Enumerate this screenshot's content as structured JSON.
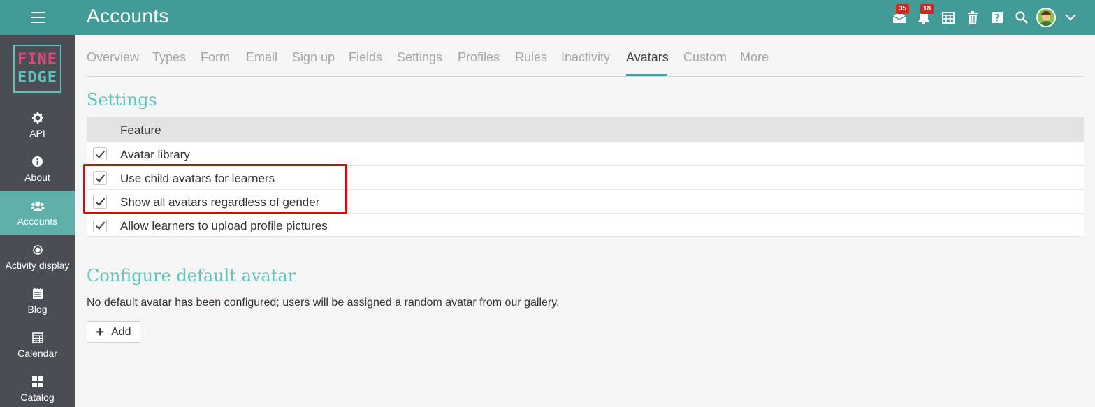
{
  "header": {
    "title": "Accounts",
    "menu_icon": "hamburger-icon",
    "icons": [
      {
        "name": "messages-icon",
        "badge": "35"
      },
      {
        "name": "notifications-icon",
        "badge": "18"
      },
      {
        "name": "calendar-icon"
      },
      {
        "name": "trash-icon"
      },
      {
        "name": "help-icon"
      },
      {
        "name": "search-icon"
      },
      {
        "name": "user-avatar"
      },
      {
        "name": "chevron-down-icon"
      }
    ]
  },
  "logo": {
    "line1": "FINE",
    "line2": "EDGE"
  },
  "sidebar": {
    "items": [
      {
        "label": "API",
        "icon": "gear-icon"
      },
      {
        "label": "About",
        "icon": "info-icon"
      },
      {
        "label": "Accounts",
        "icon": "users-icon",
        "active": true
      },
      {
        "label": "Activity display",
        "icon": "dot-icon"
      },
      {
        "label": "Blog",
        "icon": "blog-icon"
      },
      {
        "label": "Calendar",
        "icon": "calendar-icon"
      },
      {
        "label": "Catalog",
        "icon": "grid-icon"
      }
    ]
  },
  "tabs": [
    {
      "label": "Overview"
    },
    {
      "label": "Types"
    },
    {
      "label": "Form"
    },
    {
      "label": "Email"
    },
    {
      "label": "Sign up"
    },
    {
      "label": "Fields"
    },
    {
      "label": "Settings"
    },
    {
      "label": "Profiles"
    },
    {
      "label": "Rules"
    },
    {
      "label": "Inactivity"
    },
    {
      "label": "Avatars",
      "active": true
    },
    {
      "label": "Custom"
    },
    {
      "label": "More"
    }
  ],
  "settings": {
    "title": "Settings",
    "column_header": "Feature",
    "features": [
      {
        "label": "Avatar library",
        "checked": true
      },
      {
        "label": "Use child avatars for learners",
        "checked": true
      },
      {
        "label": "Show all avatars regardless of gender",
        "checked": true
      },
      {
        "label": "Allow learners to upload profile pictures",
        "checked": true
      }
    ]
  },
  "default_avatar": {
    "title": "Configure default avatar",
    "description": "No default avatar has been configured; users will be assigned a random avatar from our gallery.",
    "add_label": "Add"
  },
  "colors": {
    "topbar": "#439b97",
    "sidebar": "#4a4e54",
    "active_nav": "#5fb0a9",
    "heading": "#5ec3bd",
    "badge": "#d9261c",
    "highlight": "#ee0000"
  }
}
